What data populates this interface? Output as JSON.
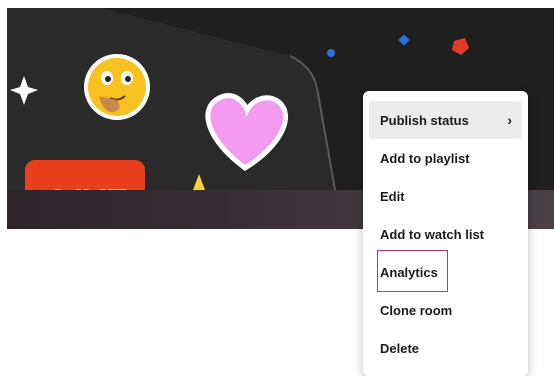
{
  "banner": {
    "live_badge_text": "LIVE",
    "colors": {
      "background": "#1f1f1f",
      "device": "#2a2a2a",
      "heart": "#f29af0",
      "emoji": "#f7c21f",
      "live_badge": "#e8401c",
      "confetti_blue": "#2f6fe0",
      "confetti_red": "#e33a28"
    }
  },
  "menu": {
    "items": [
      {
        "label": "Publish status",
        "submenu_icon": "chevron-right-icon",
        "chevron": "›"
      },
      {
        "label": "Add to playlist"
      },
      {
        "label": "Edit"
      },
      {
        "label": "Add to watch list"
      },
      {
        "label": "Analytics"
      },
      {
        "label": "Clone room"
      },
      {
        "label": "Delete"
      }
    ],
    "highlight_color": "#c0357a"
  }
}
